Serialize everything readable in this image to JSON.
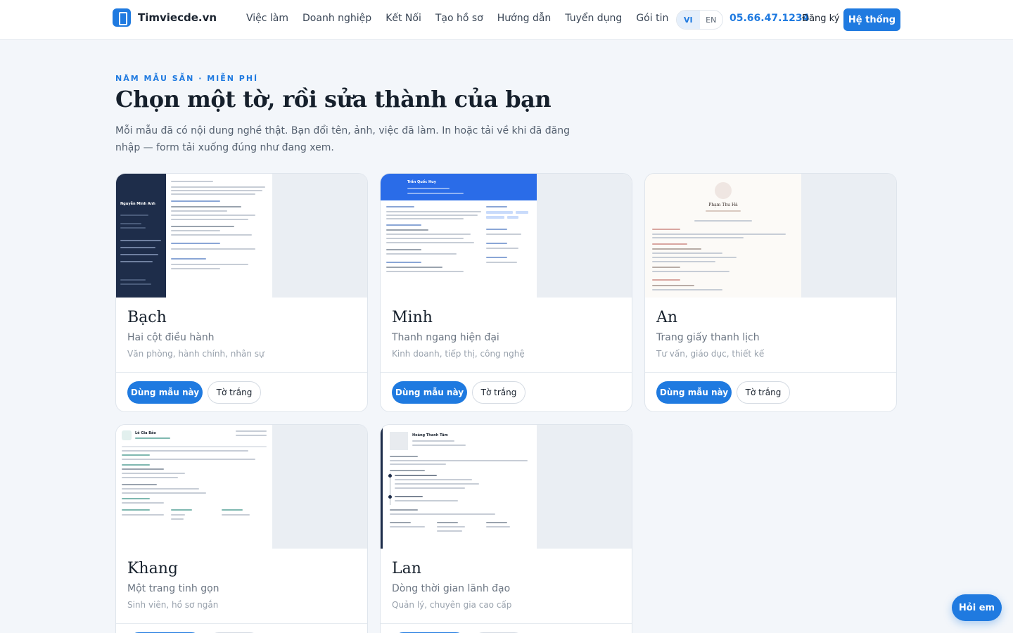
{
  "brand": {
    "name": "Timviecde.vn"
  },
  "nav": [
    "Việc làm",
    "Doanh nghiệp",
    "Kết Nối",
    "Tạo hồ sơ",
    "Hướng dẫn",
    "Tuyển dụng",
    "Gói tin"
  ],
  "lang": {
    "vi": "VI",
    "en": "EN",
    "active": "VI"
  },
  "phone": "05.66.47.1234",
  "signup": "Đăng ký",
  "system_button": "Hệ thống",
  "hero": {
    "eyebrow": "NĂM MẪU SẴN · MIỄN PHÍ",
    "title": "Chọn một tờ, rồi sửa thành của bạn",
    "lead": "Mỗi mẫu đã có nội dung nghề thật. Bạn đổi tên, ảnh, việc đã làm. In hoặc tải về khi đã đăng nhập — form tải xuống đúng như đang xem."
  },
  "templates": [
    {
      "name": "Bạch",
      "subtitle": "Hai cột điều hành",
      "tags": "Văn phòng, hành chính, nhân sự",
      "person": "Nguyễn Minh Anh",
      "style": "sidebar-dark"
    },
    {
      "name": "Minh",
      "subtitle": "Thanh ngang hiện đại",
      "tags": "Kinh doanh, tiếp thị, công nghệ",
      "person": "Trần Quốc Huy",
      "style": "blue-band"
    },
    {
      "name": "An",
      "subtitle": "Trang giấy thanh lịch",
      "tags": "Tư vấn, giáo dục, thiết kế",
      "person": "Phạm Thu Hà",
      "style": "centered-paper"
    },
    {
      "name": "Khang",
      "subtitle": "Một trang tinh gọn",
      "tags": "Sinh viên, hồ sơ ngắn",
      "person": "Lê Gia Bảo",
      "style": "compact"
    },
    {
      "name": "Lan",
      "subtitle": "Dòng thời gian lãnh đạo",
      "tags": "Quản lý, chuyên gia cao cấp",
      "person": "Hoàng Thanh Tâm",
      "style": "timeline"
    }
  ],
  "card_buttons": {
    "use": "Dùng mẫu này",
    "blank": "Tờ trắng"
  },
  "chat_button": "Hỏi em",
  "colors": {
    "accent": "#1f7ae0",
    "dark_sidebar": "#1e2d4a",
    "band_blue": "#2a6ce8"
  }
}
